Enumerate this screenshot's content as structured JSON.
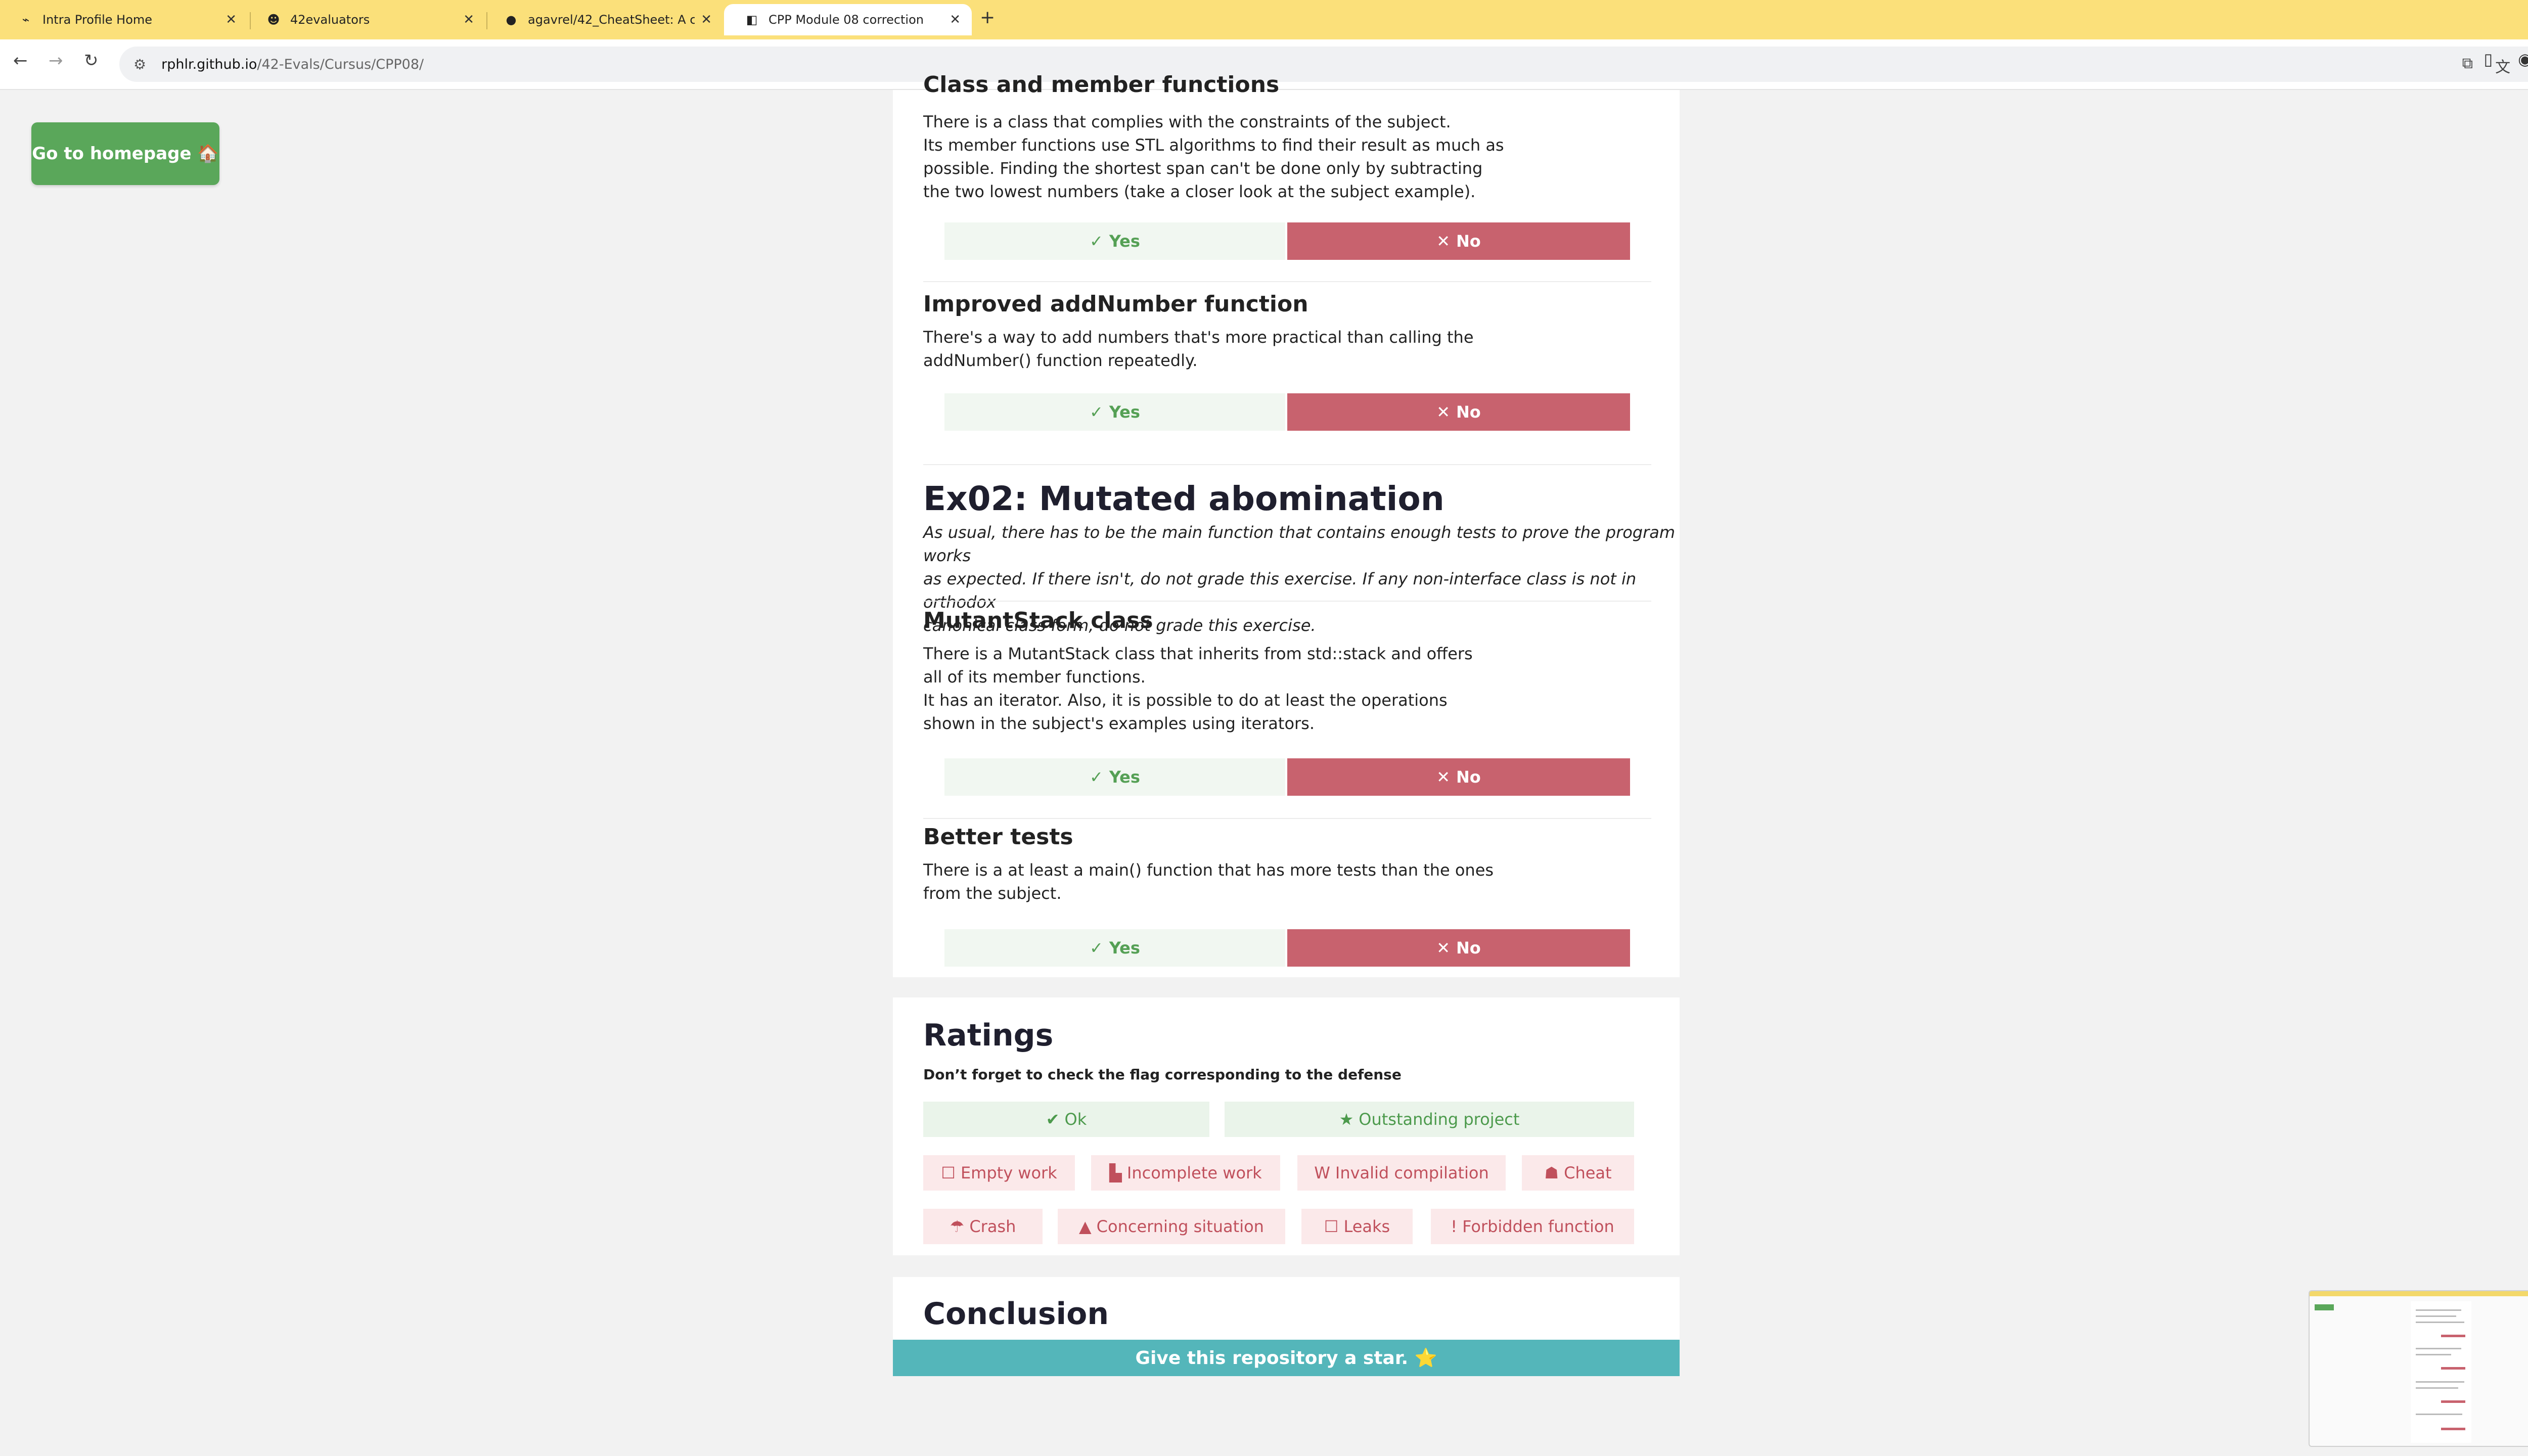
{
  "browser": {
    "tabs": [
      {
        "title": "Intra Profile Home",
        "icon": "42-logo-icon"
      },
      {
        "title": "42evaluators",
        "icon": "evaluator-icon"
      },
      {
        "title": "agavrel/42_CheatSheet: A co",
        "icon": "github-icon"
      },
      {
        "title": "CPP Module 08 correction",
        "icon": "site-icon"
      }
    ],
    "new_tab": "+",
    "url_host": "rphlr.github.io",
    "url_path": "/42-Evals/Cursus/CPP08/"
  },
  "page": {
    "home_button": "Go to homepage 🏠",
    "yes_label": "Yes",
    "no_label": "No",
    "class_section": {
      "title": "Class and member functions",
      "lines": [
        "There is a class that complies with the constraints of the subject.",
        "Its member functions use STL algorithms to find their result as much as",
        "possible. Finding the shortest span can't be done only by subtracting",
        "the two lowest numbers (take a closer look at the subject example)."
      ]
    },
    "addnumber_section": {
      "title": "Improved addNumber function",
      "lines": [
        "There's a way to add numbers that's more practical than calling the",
        "addNumber() function repeatedly."
      ]
    },
    "ex02": {
      "title": "Ex02: Mutated abomination",
      "lines": [
        "As usual, there has to be the main function that contains enough tests to prove the program works",
        "as expected. If there isn't, do not grade this exercise. If any non-interface class is not in orthodox",
        "canonical class form, do not grade this exercise."
      ]
    },
    "mutant_section": {
      "title": "MutantStack class",
      "lines": [
        "There is a MutantStack class that inherits from std::stack and offers",
        "all of its member functions.",
        "It has an iterator. Also, it is possible to do at least the operations",
        "shown in the subject's examples using iterators."
      ]
    },
    "tests_section": {
      "title": "Better tests",
      "lines": [
        "There is a at least a main() function that has more tests than the ones",
        "from the subject."
      ]
    },
    "ratings": {
      "title": "Ratings",
      "subtitle": "Don’t forget to check the flag corresponding to the defense",
      "ok": "Ok",
      "outstanding": "Outstanding project",
      "empty": "Empty work",
      "incomplete": "Incomplete work",
      "invalid": "Invalid compilation",
      "cheat": "Cheat",
      "crash": "Crash",
      "concerning": "Concerning situation",
      "leaks": "Leaks",
      "forbidden": "Forbidden function"
    },
    "conclusion": {
      "title": "Conclusion",
      "star_bar": "Give this repository a star. ⭐"
    }
  },
  "colors": {
    "tab_bar": "#fbe07a",
    "green_button": "#5aa75a",
    "no_red": "#c8626e",
    "teal_bar": "#54b6ba"
  }
}
